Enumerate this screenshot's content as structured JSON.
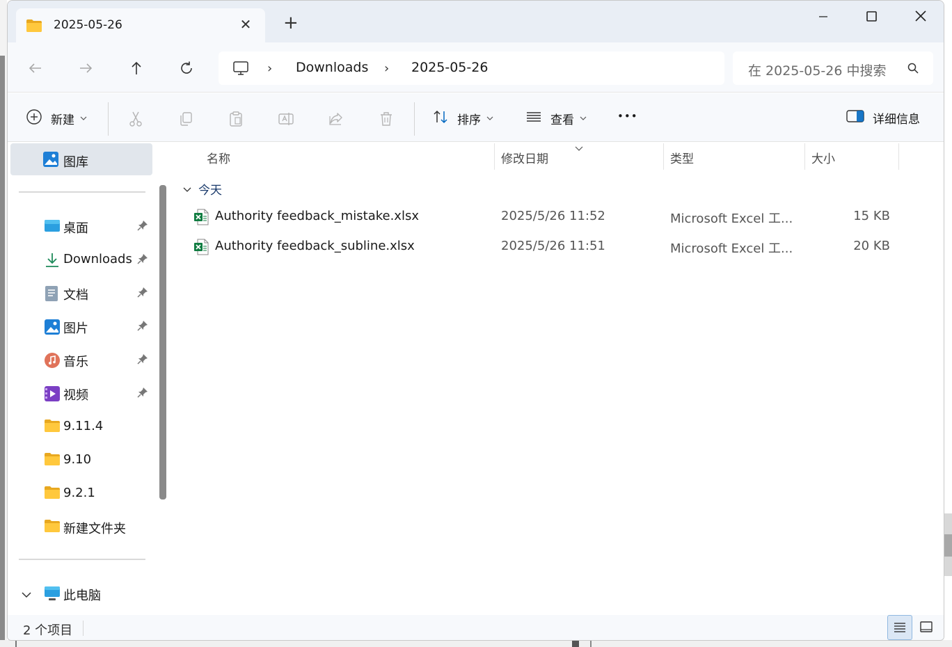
{
  "window": {
    "tab_title": "2025-05-26",
    "tab_close": "✕",
    "new_tab": "+"
  },
  "address": {
    "crumbs": [
      "Downloads",
      "2025-05-26"
    ],
    "separator": "›"
  },
  "search": {
    "placeholder": "在 2025-05-26 中搜索"
  },
  "toolbar": {
    "new_label": "新建",
    "sort_label": "排序",
    "view_label": "查看",
    "more": "•••",
    "details_label": "详细信息"
  },
  "sidebar": {
    "home": "图库",
    "items": [
      {
        "label": "桌面",
        "pinned": true,
        "icon": "desktop-icon"
      },
      {
        "label": "Downloads",
        "pinned": true,
        "icon": "download-icon"
      },
      {
        "label": "文档",
        "pinned": true,
        "icon": "document-icon"
      },
      {
        "label": "图片",
        "pinned": true,
        "icon": "pictures-icon"
      },
      {
        "label": "音乐",
        "pinned": true,
        "icon": "music-icon"
      },
      {
        "label": "视频",
        "pinned": true,
        "icon": "video-icon"
      },
      {
        "label": "9.11.4",
        "pinned": false,
        "icon": "folder-icon"
      },
      {
        "label": "9.10",
        "pinned": false,
        "icon": "folder-icon"
      },
      {
        "label": "9.2.1",
        "pinned": false,
        "icon": "folder-icon"
      },
      {
        "label": "新建文件夹",
        "pinned": false,
        "icon": "folder-icon"
      }
    ],
    "this_pc": "此电脑"
  },
  "columns": {
    "name": "名称",
    "date": "修改日期",
    "type": "类型",
    "size": "大小"
  },
  "group": {
    "label": "今天"
  },
  "files": [
    {
      "name": "Authority feedback_mistake.xlsx",
      "date": "2025/5/26 11:52",
      "type": "Microsoft Excel 工...",
      "size": "15 KB"
    },
    {
      "name": "Authority feedback_subline.xlsx",
      "date": "2025/5/26 11:51",
      "type": "Microsoft Excel 工...",
      "size": "20 KB"
    }
  ],
  "status": {
    "count": "2 个项目"
  },
  "colors": {
    "accent": "#0067c0",
    "excel_green": "#107c41",
    "folder_yellow": "#f4c242"
  }
}
